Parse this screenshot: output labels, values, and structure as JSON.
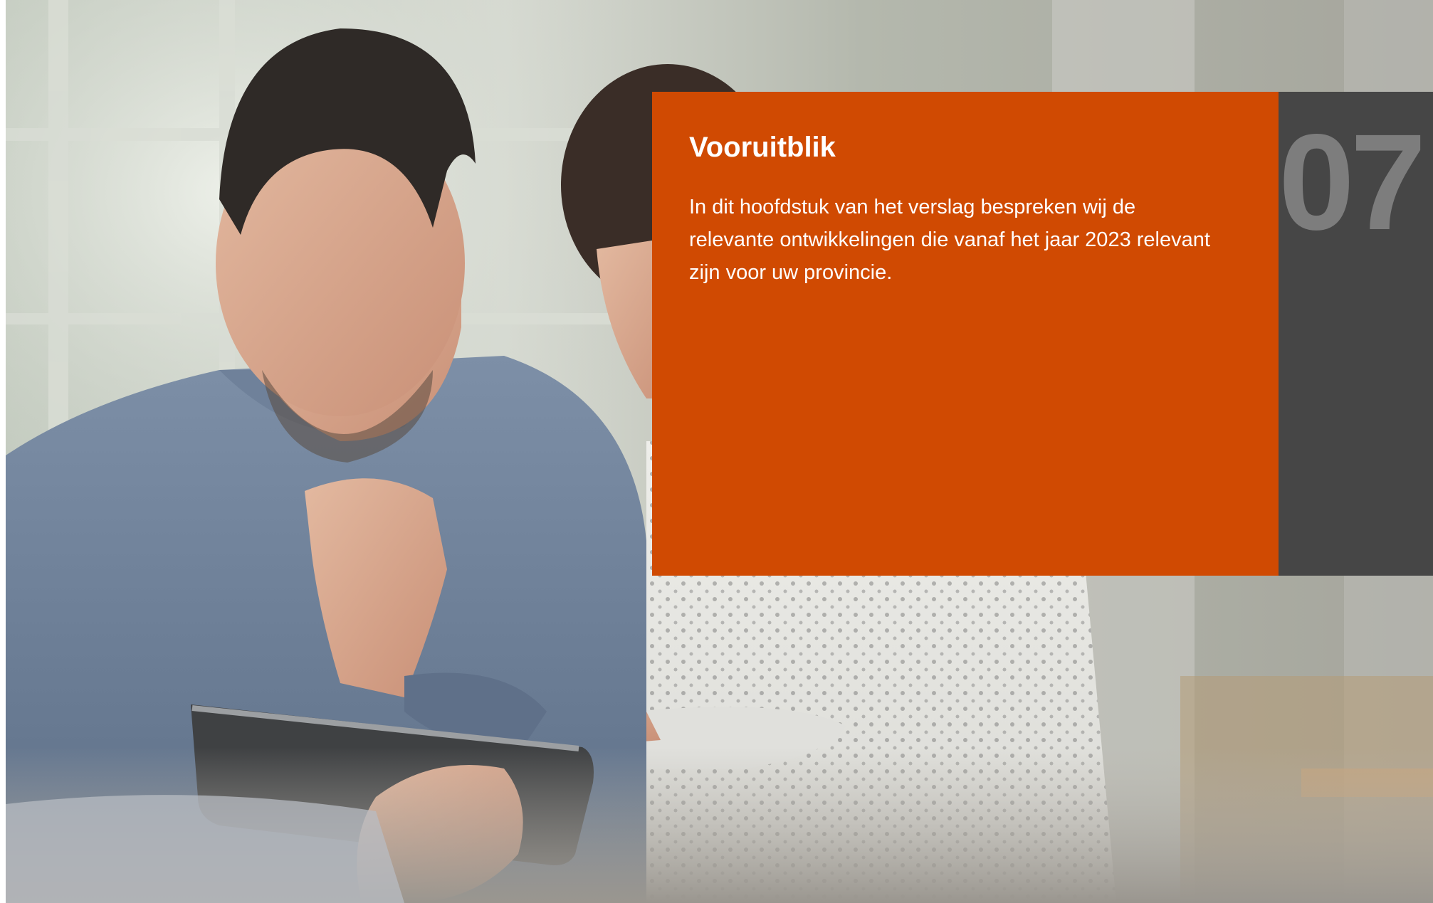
{
  "chapter": {
    "number": "07",
    "title": "Vooruitblik",
    "intro": "In dit hoofdstuk van het verslag bespreken wij de relevante ontwikkelingen die vanaf het jaar 2023 relevant zijn voor uw provincie."
  },
  "colors": {
    "accent_orange": "#d04a02",
    "panel_dark": "#464646",
    "number_grey": "#7d7d7d"
  },
  "background_image": {
    "icon": "photo-two-people-with-tablet"
  }
}
